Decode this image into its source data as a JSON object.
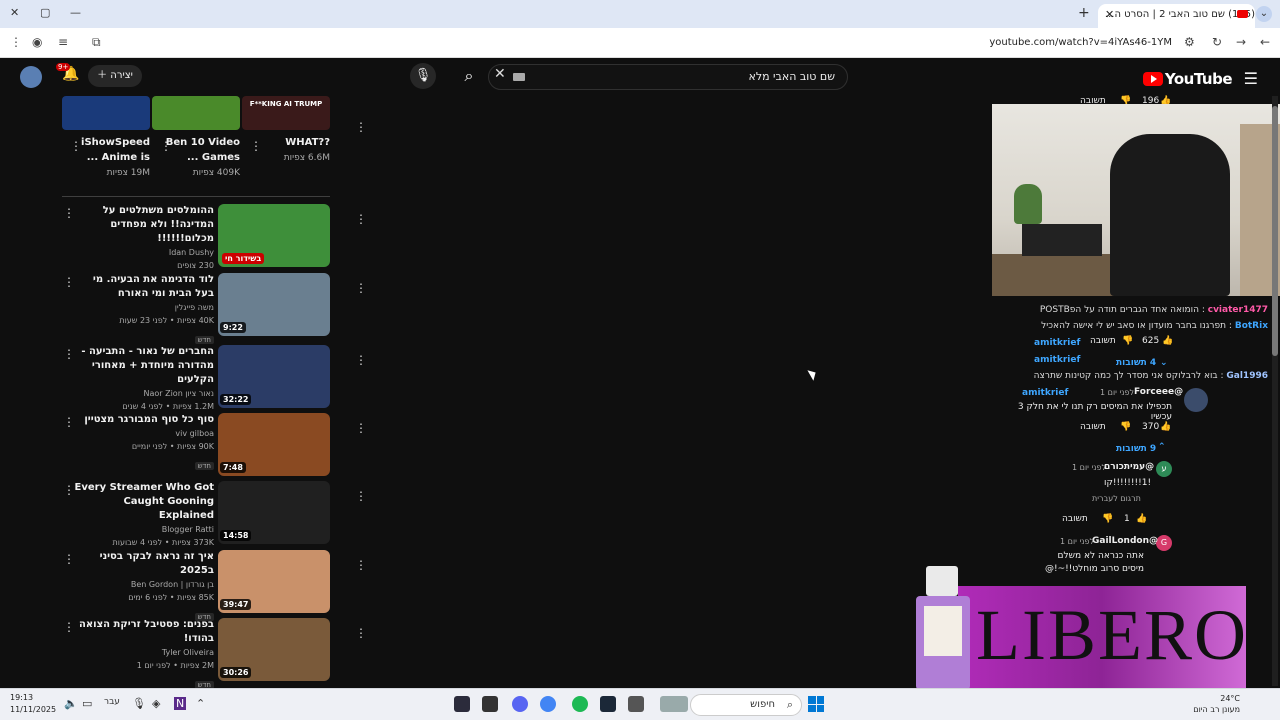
{
  "browser": {
    "tab_title": "(185) שם טוב האבי 2 | הסרט ה...",
    "url": "youtube.com/watch?v=4iYAs46-1YM"
  },
  "youtube": {
    "logo": "YouTube",
    "search_query": "שם טוב האבי מלא",
    "create_label": "יצירה",
    "notif_count": "9+"
  },
  "shorts": [
    {
      "title": "??WHAT",
      "views": "6.6M צפיות",
      "thumb_text": "F**KING AI TRUMP"
    },
    {
      "title": "Ben 10 Video Games ...",
      "views": "409K צפיות"
    },
    {
      "title": "iShowSpeed Anime is ...",
      "views": "19M צפיות"
    }
  ],
  "videos": [
    {
      "title": "ההומלסים משתלטים על המדינה!! ולא מפחדים מכלום!!!!!!",
      "channel": "Idan Dushy",
      "meta": "230 צופים",
      "duration": "בשידור חי",
      "live": true,
      "color": "#3e8f3a"
    },
    {
      "title": "לוד הדגימה את הבעיה. מי בעל הבית ומי האורח",
      "channel": "משה פייגלין",
      "meta": "40K צפיות • לפני 23 שעות",
      "duration": "9:22",
      "new": "חדש",
      "color": "#6a7f90"
    },
    {
      "title": "החברים של נאור - התביעה - מהדורה מיוחדת + מאחורי הקלעים",
      "channel": "נאור ציון Naor Zion",
      "meta": "1.2M צפיות • לפני 4 שנים",
      "duration": "32:22",
      "color": "#2b3c66"
    },
    {
      "title": "סוף כל סוף המבורגר מצטיין",
      "channel": "viv gilboa",
      "meta": "90K צפיות • לפני יומיים",
      "duration": "7:48",
      "new": "חדש",
      "color": "#8a4a22"
    },
    {
      "title": "Every Streamer Who Got Caught Gooning Explained",
      "channel": "Blogger Ratti",
      "meta": "373K צפיות • לפני 4 שבועות",
      "duration": "14:58",
      "color": "#202020"
    },
    {
      "title": "איך זה נראה לבקר בסיני ב2025",
      "channel": "בן גורדון | Ben Gordon",
      "meta": "85K צפיות • לפני 6 ימים",
      "duration": "39:47",
      "new": "חדש",
      "color": "#c9916a"
    },
    {
      "title": "בפנים: פסטיבל זריקת הצואה בהודו!",
      "channel": "Tyler Oliveira",
      "meta": "2M צפיות • לפני יום 1",
      "duration": "30:26",
      "new": "חדש",
      "color": "#7a5a3a"
    }
  ],
  "chat": [
    {
      "user": "cviater1477",
      "text": ": הומואה אחד הגברים תודה על הפPOSTB"
    },
    {
      "user": "BotRix",
      "text": ": תפרגנו בחבר מועדון או סאב יש לי אישה להאכיל"
    },
    {
      "user": "amitkrief",
      "text": ":"
    },
    {
      "user": "amitkrief",
      "text": ":"
    },
    {
      "user": "Gal1996",
      "text": ": בוא לרבלוקס אני מסדר לך כמה קטינות שתרצה"
    },
    {
      "user": "amitkrief",
      "text": ":"
    }
  ],
  "comments": {
    "top_likes": "196",
    "reply_label": "תשובה",
    "c1_user": "@Forceee",
    "c1_time": "לפני יום 1",
    "c1_text": "תכפילו את המיסים רק תנו לי את חלק 3 עכשיו",
    "c1_likes": "370",
    "c1_replies": "9 תשובות",
    "replies_4": "4 תשובות",
    "likes_625": "625",
    "r1_user": "@עמיתכורם",
    "r1_time": "לפני יום 1",
    "r1_text": "!1!!!!!!!!קו",
    "r1_translate": "תרגום לעברית",
    "r1_likes": "1",
    "r2_user": "@GailLondon",
    "r2_time": "לפני יום 1",
    "r2_text": "אתה כנראה לא משלם מיסים סרוב מוחלט!!~!@"
  },
  "ad": {
    "brand": "LIBERO"
  },
  "taskbar": {
    "time": "19:13",
    "date": "11/11/2025",
    "lang": "עבר",
    "search": "חיפוש",
    "temp": "24°C",
    "weather": "מעונן רב היום"
  }
}
